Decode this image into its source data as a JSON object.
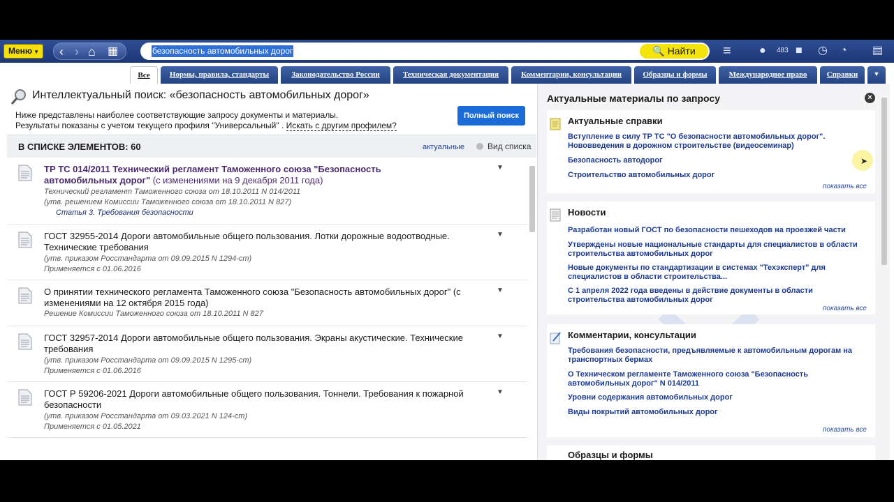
{
  "toolbar": {
    "menu_label": "Меню",
    "search_value": "безопасность автомобильных дорог",
    "find_label": "Найти",
    "user_count": "483"
  },
  "tabs": [
    {
      "label": "Все"
    },
    {
      "label": "Нормы, правила, стандарты"
    },
    {
      "label": "Законодательство России"
    },
    {
      "label": "Техническая документация"
    },
    {
      "label": "Комментарии, консультации"
    },
    {
      "label": "Образцы и формы"
    },
    {
      "label": "Международное право"
    },
    {
      "label": "Справки"
    }
  ],
  "left": {
    "title": "Интеллектуальный поиск: «безопасность автомобильных дорог»",
    "subtitle1": "Ниже представлены наиболее соответствующие запросу документы и материалы.",
    "subtitle2_prefix": "Результаты показаны с учетом текущего профиля \"Универсальный\" . ",
    "subtitle2_link": "Искать с другим профилем?",
    "full_search_label": "Полный поиск",
    "count_label": "В СПИСКЕ ЭЛЕМЕНТОВ: 60",
    "actual_label": "актуальные",
    "view_label": "Вид списка",
    "results": [
      {
        "title_line1": "ТР ТС 014/2011 Технический регламент Таможенного союза \"Безопасность",
        "title_line2": "автомобильных дорог\"",
        "changes": " (с изменениями на 9 декабря 2011 года)",
        "meta1": "Технический регламент Таможенного союза от 18.10.2011 N 014/2011",
        "meta2": "(утв. решением Комиссии Таможенного союза от 18.10.2011 N 827)",
        "article": "Статья 3. Требования безопасности"
      },
      {
        "title": "ГОСТ 32955-2014 Дороги автомобильные общего пользования. Лотки дорожные водоотводные. Технические требования",
        "meta1": "(утв. приказом Росстандарта от 09.09.2015 N 1294-ст)",
        "meta2": "Применяется с 01.06.2016"
      },
      {
        "title": "О принятии технического регламента Таможенного союза \"Безопасность автомобильных дорог\" (с изменениями на 12 октября 2015 года)",
        "meta1": "Решение Комиссии Таможенного союза от 18.10.2011 N 827"
      },
      {
        "title": "ГОСТ 32957-2014 Дороги автомобильные общего пользования. Экраны акустические. Технические требования",
        "meta1": "(утв. приказом Росстандарта от 09.09.2015 N 1295-ст)",
        "meta2": "Применяется с 01.06.2016"
      },
      {
        "title": "ГОСТ Р 59206-2021 Дороги автомобильные общего пользования. Тоннели. Требования к пожарной безопасности",
        "meta1": "(утв. приказом Росстандарта от 09.03.2021 N 124-ст)",
        "meta2": "Применяется с 01.05.2021"
      }
    ]
  },
  "right": {
    "title": "Актуальные материалы по запросу",
    "show_all": "показать все",
    "sections": [
      {
        "title": "Актуальные справки",
        "links": [
          "Вступление в силу ТР ТС \"О безопасности автомобильных дорог\". Нововведения в дорожном строительстве (видеосеминар)",
          "Безопасность автодорог",
          "Строительство автомобильных дорог"
        ]
      },
      {
        "title": "Новости",
        "links": [
          "Разработан новый ГОСТ по безопасности пешеходов на проезжей части",
          "Утверждены новые национальные стандарты для специалистов в области строительства автомобильных дорог",
          "Новые документы по стандартизации в системах \"Техэксперт\" для специалистов в области строительства...",
          "С 1 апреля 2022 года введены в действие документы в области строительства автомобильных дорог"
        ]
      },
      {
        "title": "Комментарии, консультации",
        "links": [
          "Требования безопасности, предъявляемые к автомобильным дорогам на транспортных бермах",
          "О Техническом регламенте Таможенного союза \"Безопасность автомобильных дорог\" N 014/2011",
          "Уровни содержания автомобильных дорог",
          "Виды покрытий автомобильных дорог"
        ]
      },
      {
        "title": "Образцы и формы"
      }
    ]
  }
}
